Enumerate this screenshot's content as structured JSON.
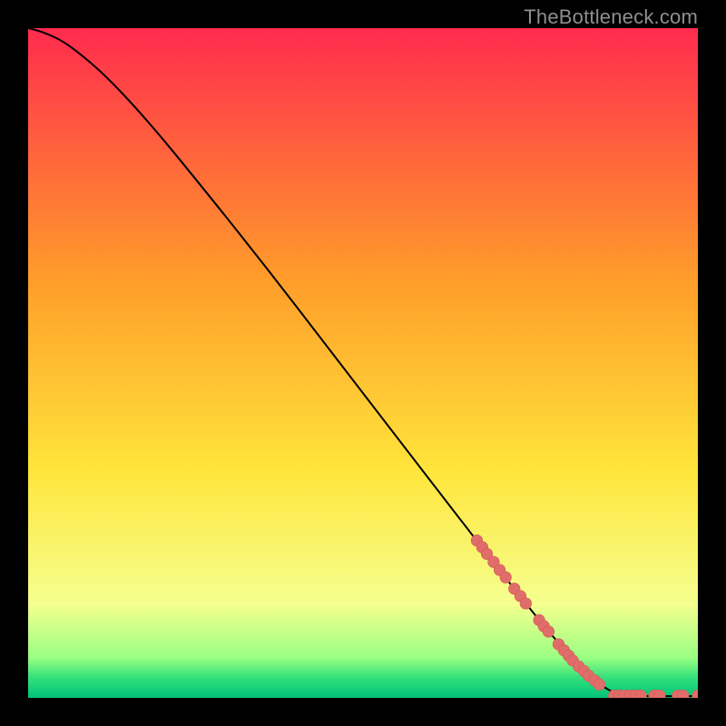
{
  "watermark": "TheBottleneck.com",
  "colors": {
    "bg": "#000000",
    "curve": "#000000",
    "marker_fill": "#e06d69",
    "marker_stroke": "#d45a56",
    "gradient_top": "#ff2b4e",
    "gradient_orange": "#ff9e2a",
    "gradient_yellow": "#ffe53b",
    "gradient_pale": "#f5ff8f",
    "gradient_green1": "#9aff82",
    "gradient_green2": "#33e07a",
    "gradient_green3": "#00c27a"
  },
  "chart_data": {
    "type": "line",
    "title": "",
    "xlabel": "",
    "ylabel": "",
    "xlim": [
      0,
      100
    ],
    "ylim": [
      0,
      100
    ],
    "curve": [
      {
        "x": 0,
        "y": 100
      },
      {
        "x": 2,
        "y": 99.5
      },
      {
        "x": 5,
        "y": 98.2
      },
      {
        "x": 8,
        "y": 96.0
      },
      {
        "x": 12,
        "y": 92.5
      },
      {
        "x": 18,
        "y": 86.0
      },
      {
        "x": 25,
        "y": 77.5
      },
      {
        "x": 35,
        "y": 65.0
      },
      {
        "x": 45,
        "y": 52.0
      },
      {
        "x": 55,
        "y": 39.0
      },
      {
        "x": 65,
        "y": 26.0
      },
      {
        "x": 72,
        "y": 17.0
      },
      {
        "x": 78,
        "y": 9.5
      },
      {
        "x": 83,
        "y": 4.0
      },
      {
        "x": 86,
        "y": 1.5
      },
      {
        "x": 88,
        "y": 0.6
      },
      {
        "x": 90,
        "y": 0.3
      },
      {
        "x": 95,
        "y": 0.25
      },
      {
        "x": 100,
        "y": 0.25
      }
    ],
    "markers": [
      {
        "x": 67.0,
        "y": 23.5
      },
      {
        "x": 67.8,
        "y": 22.5
      },
      {
        "x": 68.5,
        "y": 21.5
      },
      {
        "x": 69.5,
        "y": 20.3
      },
      {
        "x": 70.4,
        "y": 19.1
      },
      {
        "x": 71.3,
        "y": 18.0
      },
      {
        "x": 72.6,
        "y": 16.3
      },
      {
        "x": 73.5,
        "y": 15.2
      },
      {
        "x": 74.3,
        "y": 14.1
      },
      {
        "x": 76.3,
        "y": 11.6
      },
      {
        "x": 77.0,
        "y": 10.7
      },
      {
        "x": 77.7,
        "y": 9.9
      },
      {
        "x": 79.2,
        "y": 8.0
      },
      {
        "x": 80.0,
        "y": 7.1
      },
      {
        "x": 80.7,
        "y": 6.3
      },
      {
        "x": 81.3,
        "y": 5.6
      },
      {
        "x": 82.2,
        "y": 4.7
      },
      {
        "x": 83.0,
        "y": 4.0
      },
      {
        "x": 83.7,
        "y": 3.3
      },
      {
        "x": 84.6,
        "y": 2.6
      },
      {
        "x": 85.3,
        "y": 2.0
      },
      {
        "x": 87.5,
        "y": 0.35
      },
      {
        "x": 88.3,
        "y": 0.35
      },
      {
        "x": 89.0,
        "y": 0.35
      },
      {
        "x": 89.9,
        "y": 0.35
      },
      {
        "x": 90.7,
        "y": 0.35
      },
      {
        "x": 91.5,
        "y": 0.35
      },
      {
        "x": 93.5,
        "y": 0.35
      },
      {
        "x": 94.3,
        "y": 0.35
      },
      {
        "x": 97.0,
        "y": 0.35
      },
      {
        "x": 97.8,
        "y": 0.35
      },
      {
        "x": 100.0,
        "y": 0.35
      }
    ]
  }
}
